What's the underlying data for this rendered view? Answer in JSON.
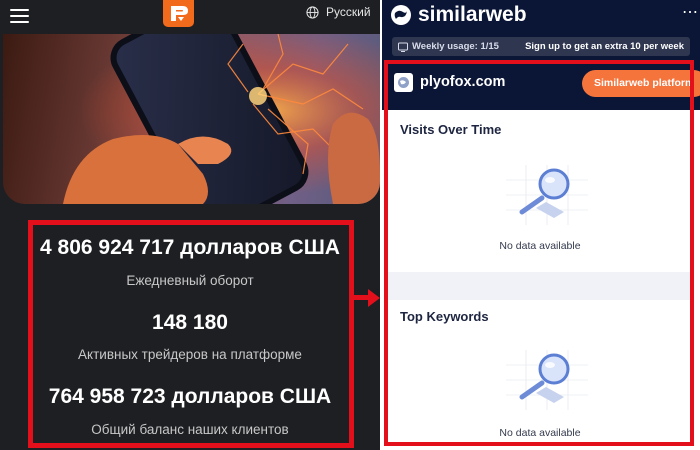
{
  "left": {
    "language": "Русский",
    "stats": [
      {
        "value": "4 806 924 717 долларов США",
        "label": "Ежедневный оборот"
      },
      {
        "value": "148 180",
        "label": "Активных трейдеров на платформе"
      },
      {
        "value": "764 958 723 долларов США",
        "label": "Общий баланс наших клиентов"
      }
    ]
  },
  "right": {
    "brand": "similarweb",
    "more": "⋯",
    "usage": "Weekly usage: 1/15",
    "usage_cta": "Sign up to get an extra 10 per week",
    "domain": "plyofox.com",
    "platform_button": "Similarweb platform",
    "sections": [
      {
        "title": "Visits Over Time",
        "empty": "No data available"
      },
      {
        "title": "Top Keywords",
        "empty": "No data available"
      }
    ]
  },
  "colors": {
    "highlight": "#e3101c",
    "brand_accent": "#f26a1b",
    "sw_navy": "#0b1637",
    "sw_orange": "#f5743c"
  }
}
